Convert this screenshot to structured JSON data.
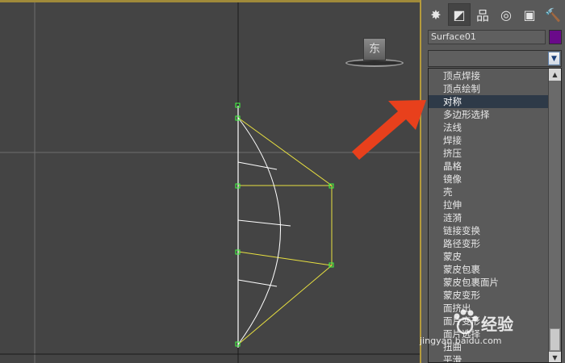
{
  "viewport": {
    "view_label": "东",
    "grid_color": "#767676",
    "wire_yellow": "#e8e040",
    "wire_white": "#ffffff",
    "vertex_green": "#40ff40"
  },
  "panel": {
    "tabs": [
      {
        "icon": "sun-icon",
        "glyph": "✸"
      },
      {
        "icon": "modify-curve-icon",
        "glyph": "◩"
      },
      {
        "icon": "hierarchy-icon",
        "glyph": "品"
      },
      {
        "icon": "motion-icon",
        "glyph": "◎"
      },
      {
        "icon": "display-icon",
        "glyph": "▣"
      },
      {
        "icon": "utilities-hammer-icon",
        "glyph": "🔨"
      }
    ],
    "object_name": "Surface01",
    "object_color": "#6a0a8a",
    "modifier_list_value": ""
  },
  "modifier_dropdown": {
    "items": [
      "顶点焊接",
      "顶点绘制",
      "对称",
      "多边形选择",
      "法线",
      "焊接",
      "挤压",
      "晶格",
      "镜像",
      "壳",
      "拉伸",
      "涟漪",
      "链接变换",
      "路径变形",
      "蒙皮",
      "蒙皮包裹",
      "蒙皮包裹面片",
      "蒙皮变形",
      "面挤出",
      "面片变形",
      "面片选择",
      "扭曲",
      "平滑"
    ],
    "selected_index": 2,
    "selected": "对称"
  },
  "watermark": {
    "name": "经验",
    "url": "jingyan.baidu.com"
  },
  "annotation": {
    "arrow_color": "#e8401c"
  }
}
